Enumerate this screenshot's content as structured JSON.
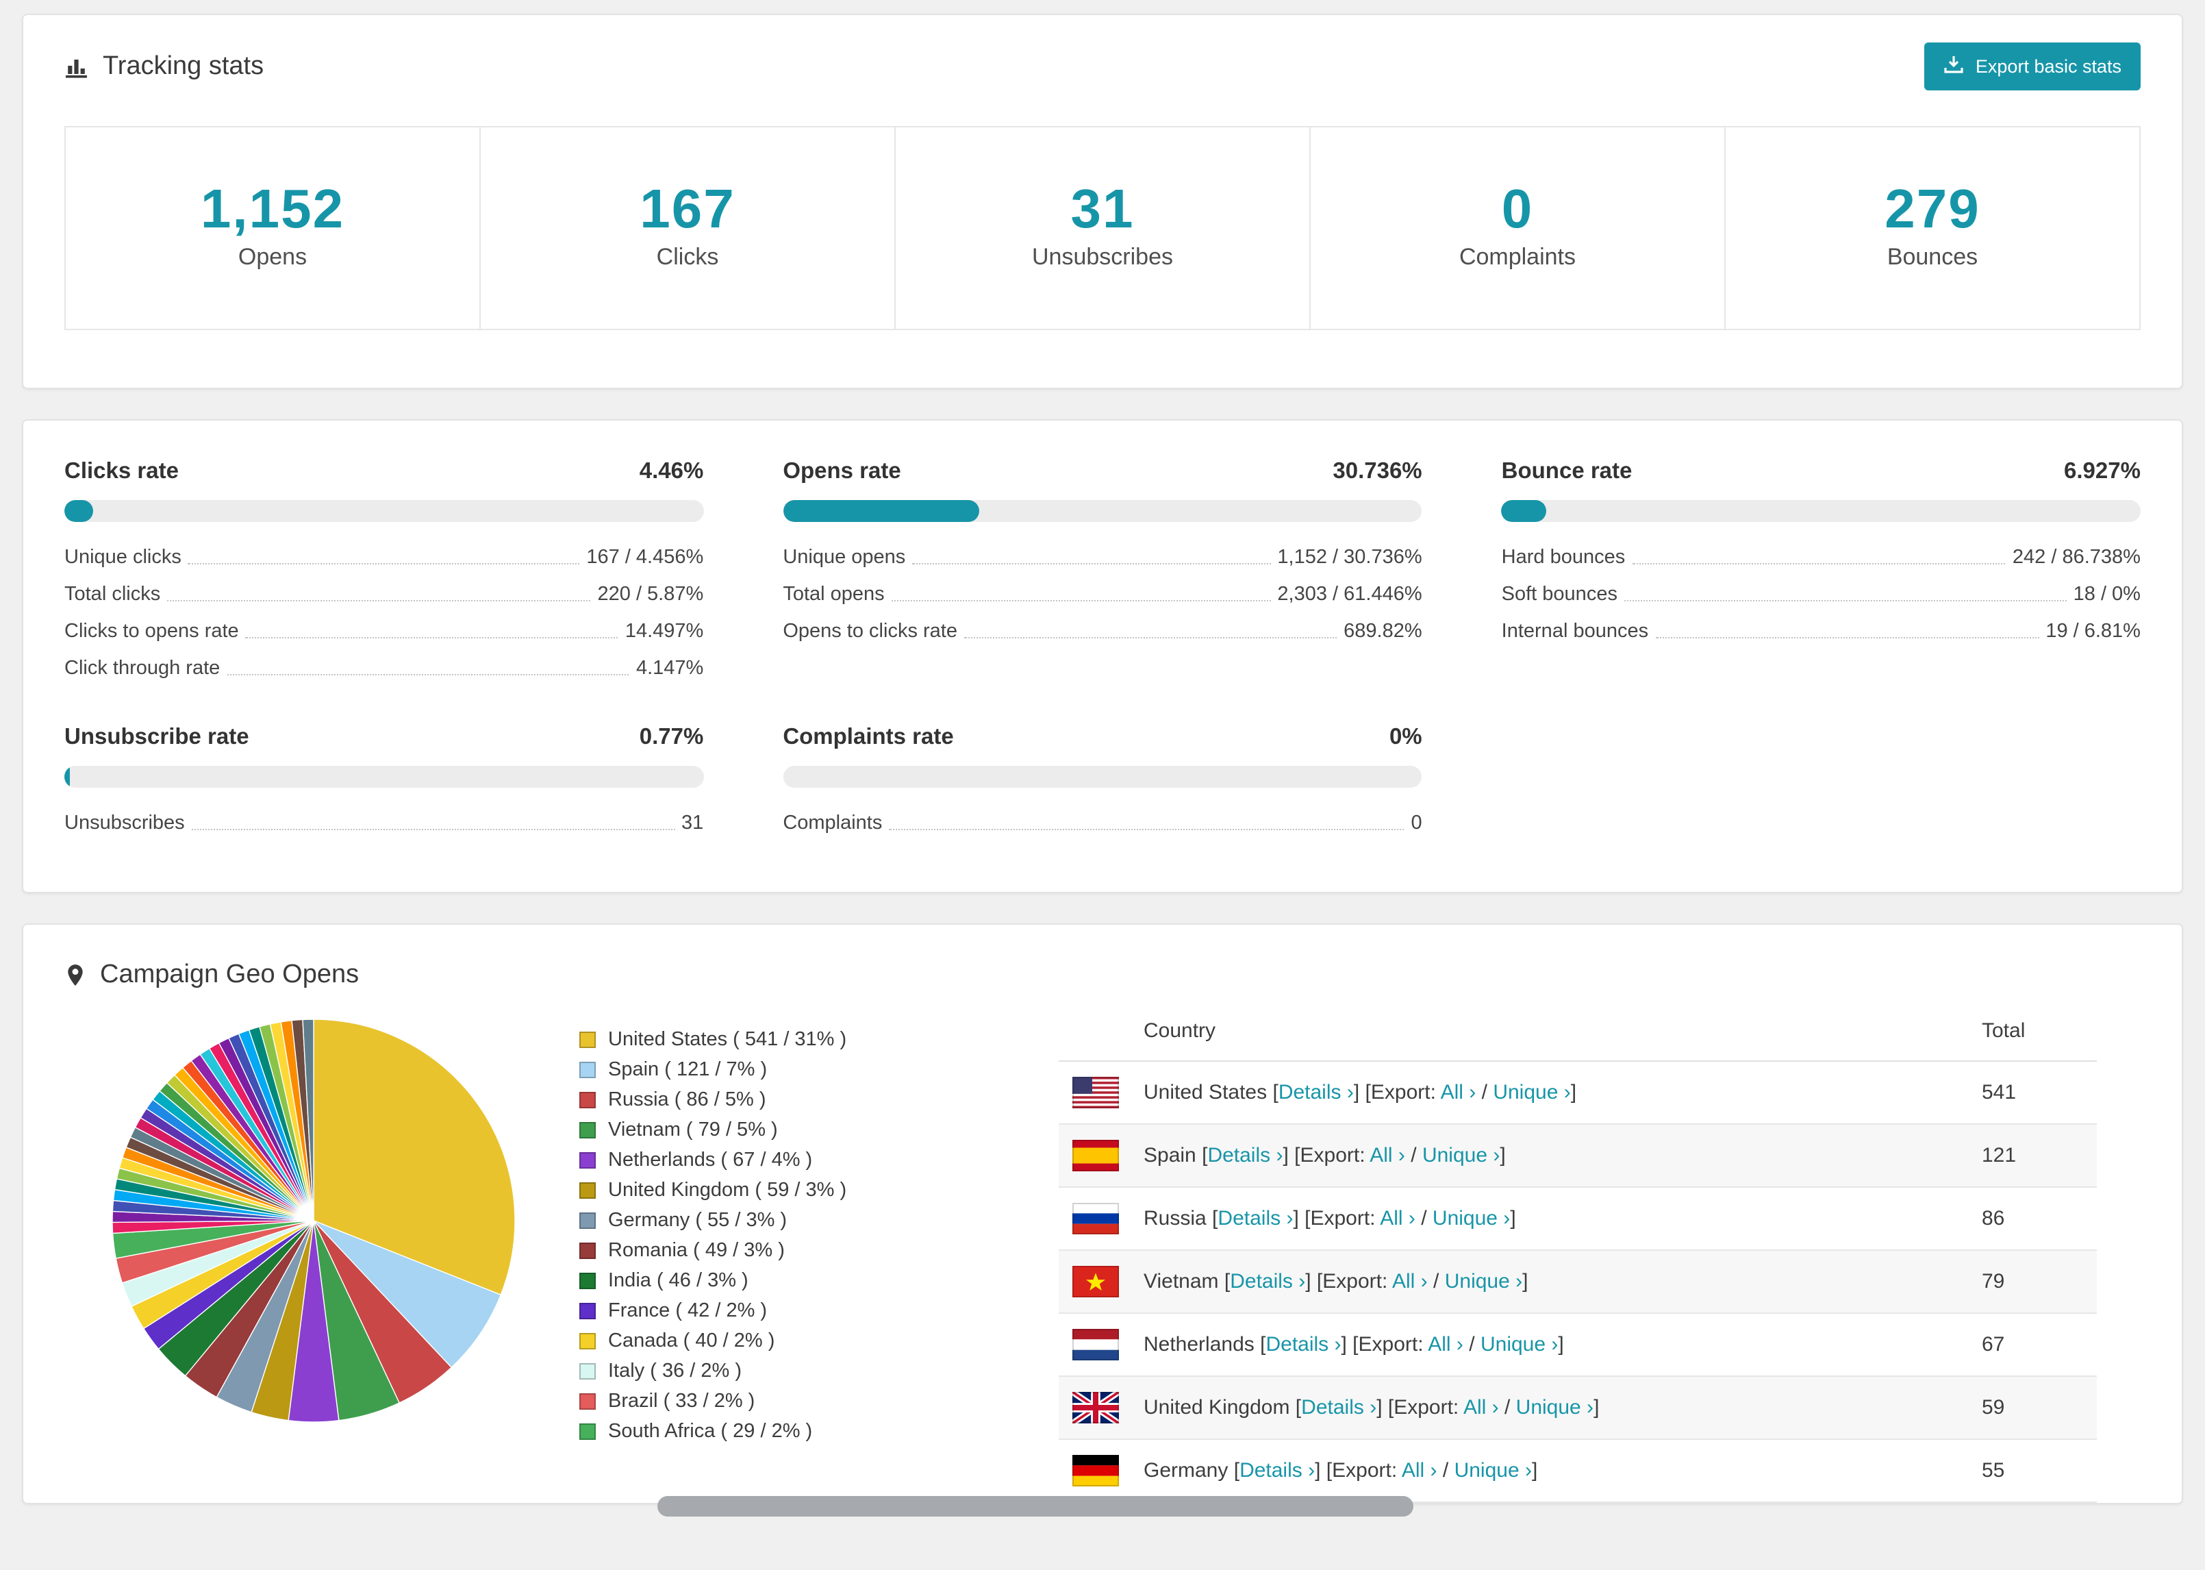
{
  "accent_color": "#1795a8",
  "tracking": {
    "title": "Tracking stats",
    "export_button": "Export basic stats",
    "stats": [
      {
        "value": "1,152",
        "label": "Opens"
      },
      {
        "value": "167",
        "label": "Clicks"
      },
      {
        "value": "31",
        "label": "Unsubscribes"
      },
      {
        "value": "0",
        "label": "Complaints"
      },
      {
        "value": "279",
        "label": "Bounces"
      }
    ]
  },
  "rates": [
    {
      "title": "Clicks rate",
      "value": "4.46%",
      "pct": 4.46,
      "rows": [
        {
          "label": "Unique clicks",
          "value": "167 / 4.456%"
        },
        {
          "label": "Total clicks",
          "value": "220 / 5.87%"
        },
        {
          "label": "Clicks to opens rate",
          "value": "14.497%"
        },
        {
          "label": "Click through rate",
          "value": "4.147%"
        }
      ]
    },
    {
      "title": "Opens rate",
      "value": "30.736%",
      "pct": 30.736,
      "rows": [
        {
          "label": "Unique opens",
          "value": "1,152 / 30.736%"
        },
        {
          "label": "Total opens",
          "value": "2,303 / 61.446%"
        },
        {
          "label": "Opens to clicks rate",
          "value": "689.82%"
        }
      ]
    },
    {
      "title": "Bounce rate",
      "value": "6.927%",
      "pct": 6.927,
      "rows": [
        {
          "label": "Hard bounces",
          "value": "242 / 86.738%"
        },
        {
          "label": "Soft bounces",
          "value": "18 / 0%"
        },
        {
          "label": "Internal bounces",
          "value": "19 / 6.81%"
        }
      ]
    },
    {
      "title": "Unsubscribe rate",
      "value": "0.77%",
      "pct": 0.77,
      "rows": [
        {
          "label": "Unsubscribes",
          "value": "31"
        }
      ]
    },
    {
      "title": "Complaints rate",
      "value": "0%",
      "pct": 0,
      "rows": [
        {
          "label": "Complaints",
          "value": "0"
        }
      ]
    }
  ],
  "geo": {
    "title": "Campaign Geo Opens",
    "table": {
      "headers": {
        "country": "Country",
        "total": "Total"
      },
      "details_label": "Details ›",
      "export_label": "Export:",
      "all_label": "All ›",
      "unique_label": "Unique ›",
      "rows": [
        {
          "flag": "us",
          "country": "United States",
          "total": "541"
        },
        {
          "flag": "es",
          "country": "Spain",
          "total": "121"
        },
        {
          "flag": "ru",
          "country": "Russia",
          "total": "86"
        },
        {
          "flag": "vn",
          "country": "Vietnam",
          "total": "79"
        },
        {
          "flag": "nl",
          "country": "Netherlands",
          "total": "67"
        },
        {
          "flag": "gb",
          "country": "United Kingdom",
          "total": "59"
        },
        {
          "flag": "de",
          "country": "Germany",
          "total": "55"
        }
      ]
    }
  },
  "chart_data": {
    "type": "pie",
    "title": "Campaign Geo Opens",
    "legend_position": "right",
    "labels": [
      "United States",
      "Spain",
      "Russia",
      "Vietnam",
      "Netherlands",
      "United Kingdom",
      "Germany",
      "Romania",
      "India",
      "France",
      "Canada",
      "Italy",
      "Brazil",
      "South Africa"
    ],
    "values": [
      541,
      121,
      86,
      79,
      67,
      59,
      55,
      49,
      46,
      42,
      40,
      36,
      33,
      29
    ],
    "percents": [
      31,
      7,
      5,
      5,
      4,
      3,
      3,
      3,
      3,
      2,
      2,
      2,
      2,
      2
    ],
    "colors": [
      "#e8c32e",
      "#a6d4f2",
      "#c94747",
      "#3f9e4d",
      "#8a3fd1",
      "#bb9912",
      "#7e99b0",
      "#973b3b",
      "#1d7a33",
      "#5e2fc9",
      "#f4d029",
      "#d8f7f3",
      "#e35b5b",
      "#46b15a"
    ],
    "others_percent": 26,
    "others_slice_count": 30,
    "others_palette": [
      "#e91e63",
      "#7b1fa2",
      "#3f51b5",
      "#03a9f4",
      "#00897b",
      "#8bc34a",
      "#fdd835",
      "#fb8c00",
      "#6d4c41",
      "#607d8b",
      "#d81b60",
      "#5e35b1",
      "#1e88e5",
      "#00acc1",
      "#43a047",
      "#c0ca33",
      "#ffb300",
      "#f4511e",
      "#8e24aa",
      "#26c6da"
    ]
  }
}
